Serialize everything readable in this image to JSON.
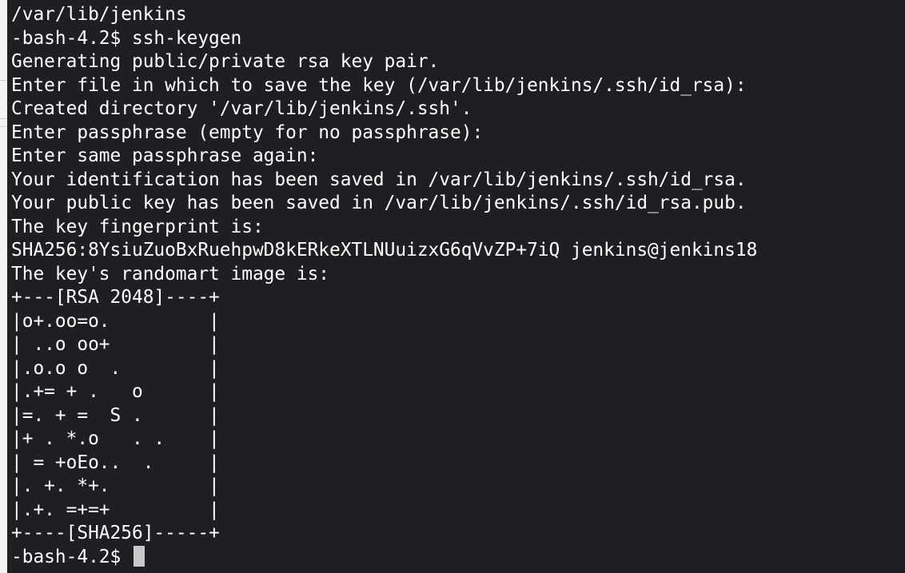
{
  "terminal": {
    "lines": [
      "/var/lib/jenkins",
      "-bash-4.2$ ssh-keygen",
      "Generating public/private rsa key pair.",
      "Enter file in which to save the key (/var/lib/jenkins/.ssh/id_rsa):",
      "Created directory '/var/lib/jenkins/.ssh'.",
      "Enter passphrase (empty for no passphrase):",
      "Enter same passphrase again:",
      "Your identification has been saved in /var/lib/jenkins/.ssh/id_rsa.",
      "Your public key has been saved in /var/lib/jenkins/.ssh/id_rsa.pub.",
      "The key fingerprint is:",
      "SHA256:8YsiuZuoBxRuehpwD8kERkeXTLNUuizxG6qVvZP+7iQ jenkins@jenkins18",
      "The key's randomart image is:",
      "+---[RSA 2048]----+",
      "|o+.oo=o.         |",
      "| ..o oo+         |",
      "|.o.o o  .        |",
      "|.+= + .   o      |",
      "|=. + =  S .      |",
      "|+ . *.o   . .    |",
      "| = +oEo..  .     |",
      "|. +. *+.         |",
      "|.+. =+=+         |",
      "+----[SHA256]-----+"
    ],
    "prompt": "-bash-4.2$ "
  }
}
